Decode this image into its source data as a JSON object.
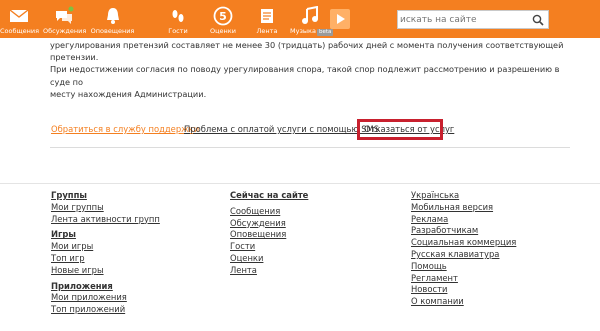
{
  "header": {
    "nav": [
      {
        "label": "Сообщения",
        "icon": "envelope-icon"
      },
      {
        "label": "Обсуждения",
        "icon": "chat-bubbles-icon"
      },
      {
        "label": "Оповещения",
        "icon": "bell-icon"
      },
      {
        "label": "Гости",
        "icon": "footprints-icon"
      },
      {
        "label": "Оценки",
        "icon": "rating-5-icon",
        "badge": "5"
      },
      {
        "label": "Лента",
        "icon": "feed-icon"
      },
      {
        "label": "Музыка",
        "icon": "music-note-icon",
        "tag": "beta"
      }
    ],
    "search_placeholder": "искать на сайте",
    "search_icon": "search-icon"
  },
  "content": {
    "paragraph_lines": [
      "урегулирования претензий составляет не менее 30 (тридцать) рабочих дней с момента получения соответствующей претензии.",
      "При недостижении согласия по поводу урегулирования спора, такой спор подлежит рассмотрению и разрешению в суде по",
      "месту нахождения Администрации."
    ]
  },
  "action_links": {
    "support": "Обратиться в службу поддержки",
    "sms_problem": "Проблема с оплатой услуги с помощью SMS",
    "refuse": "Отказаться от услуг"
  },
  "footer": {
    "col1": {
      "groups": {
        "title": "Группы",
        "items": [
          "Мои группы",
          "Лента активности групп"
        ]
      },
      "games": {
        "title": "Игры",
        "items": [
          "Мои игры",
          "Топ игр",
          "Новые игры"
        ]
      },
      "apps": {
        "title": "Приложения",
        "items": [
          "Мои приложения",
          "Топ приложений"
        ]
      }
    },
    "col2": {
      "title": "Сейчас на сайте",
      "items": [
        "Сообщения",
        "Обсуждения",
        "Оповещения",
        "Гости",
        "Оценки",
        "Лента"
      ]
    },
    "col3": {
      "items": [
        "Українська",
        "Мобильная версия",
        "Реклама",
        "Разработчикам",
        "Социальная коммерция",
        "Русская клавиатура",
        "Помощь",
        "Регламент",
        "Новости",
        "О компании"
      ]
    }
  },
  "colors": {
    "brand_orange": "#f47f20",
    "highlight_red": "#c8202e"
  }
}
